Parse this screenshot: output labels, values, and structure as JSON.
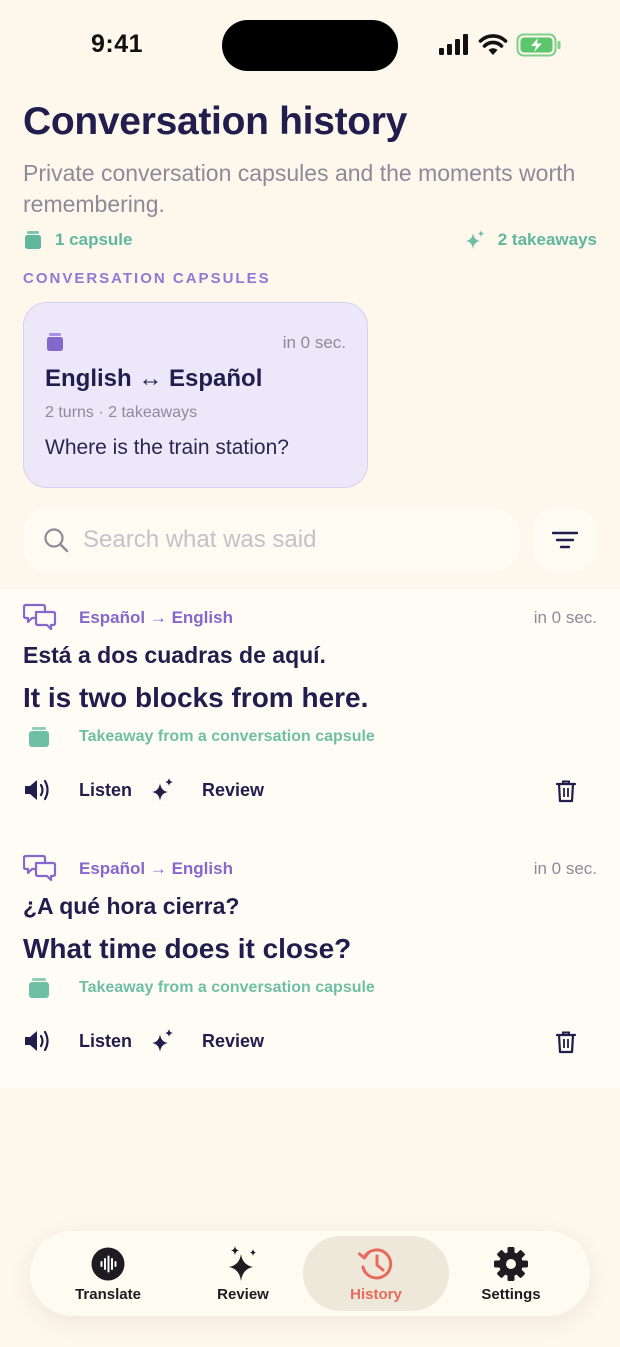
{
  "status_bar": {
    "time": "9:41"
  },
  "page": {
    "title": "Conversation history",
    "subtitle": "Private conversation capsules and the moments worth remembering.",
    "capsule_count": "1 capsule",
    "takeaway_count": "2 takeaways",
    "section_label": "CONVERSATION CAPSULES"
  },
  "capsule": {
    "time": "in 0 sec.",
    "title": "English ↔ Español",
    "meta": "2 turns · 2 takeaways",
    "phrase": "Where is the train station?"
  },
  "search": {
    "placeholder": "Search what was said",
    "value": ""
  },
  "entries": [
    {
      "lang": "Español → English",
      "time": "in 0 sec.",
      "source": "Está a dos cuadras de aquí.",
      "target": "It is two blocks from here.",
      "note": "Takeaway from a conversation capsule",
      "listen_label": "Listen",
      "review_label": "Review"
    },
    {
      "lang": "Español → English",
      "time": "in 0 sec.",
      "source": "¿A qué hora cierra?",
      "target": "What time does it close?",
      "note": "Takeaway from a conversation capsule",
      "listen_label": "Listen",
      "review_label": "Review"
    }
  ],
  "tabs": [
    {
      "label": "Translate",
      "icon": "waveform-icon"
    },
    {
      "label": "Review",
      "icon": "sparkles-icon"
    },
    {
      "label": "History",
      "icon": "history-clock-icon",
      "active": true
    },
    {
      "label": "Settings",
      "icon": "gear-icon"
    }
  ],
  "colors": {
    "background": "#fdf7ec",
    "accent_purple": "#8468cb",
    "accent_green": "#5fb79d",
    "active_tab": "#e76a5d",
    "capsule_card": "#ece8fa"
  }
}
